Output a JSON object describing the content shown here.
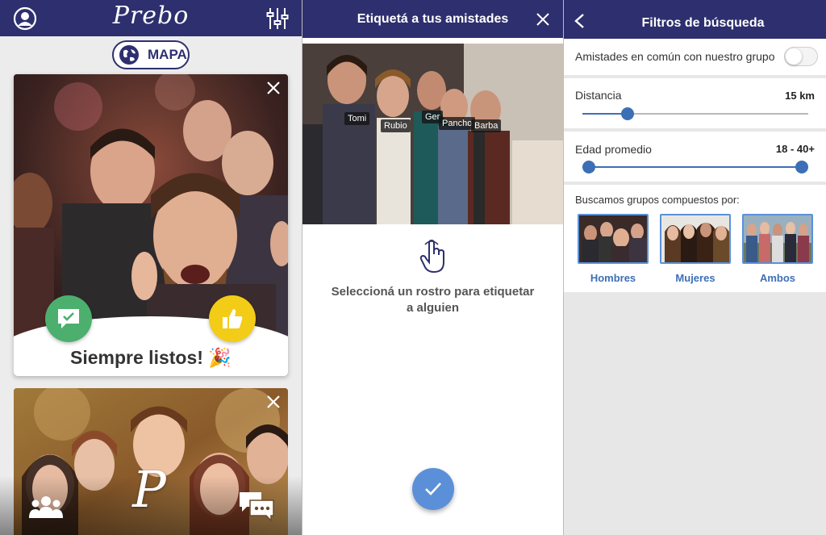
{
  "screen1": {
    "app_logo": "Prebo",
    "map_button": "MAPA",
    "card1_title": "Siempre listos! 🎉",
    "card2_logo": "P"
  },
  "screen2": {
    "title": "Etiquetá a tus amistades",
    "tags": [
      "Tomi",
      "Rubio",
      "Ger",
      "Pancho",
      "Barba"
    ],
    "hint": "Seleccioná un rostro para etiquetar a alguien"
  },
  "screen3": {
    "title": "Filtros de búsqueda",
    "common_friends_label": "Amistades en común con nuestro grupo",
    "common_friends_on": false,
    "distance_label": "Distancia",
    "distance_value": "15 km",
    "distance_level": 0.18,
    "age_label": "Edad promedio",
    "age_value": "18 - 40+",
    "age_range_level": [
      0.0,
      1.0
    ],
    "groups_label": "Buscamos grupos compuestos por:",
    "groups": [
      "Hombres",
      "Mujeres",
      "Ambos"
    ]
  },
  "colors": {
    "header": "#2e2f6e",
    "accent_blue": "#3d6fb6",
    "green": "#4caf6e",
    "yellow": "#f2cc17"
  }
}
